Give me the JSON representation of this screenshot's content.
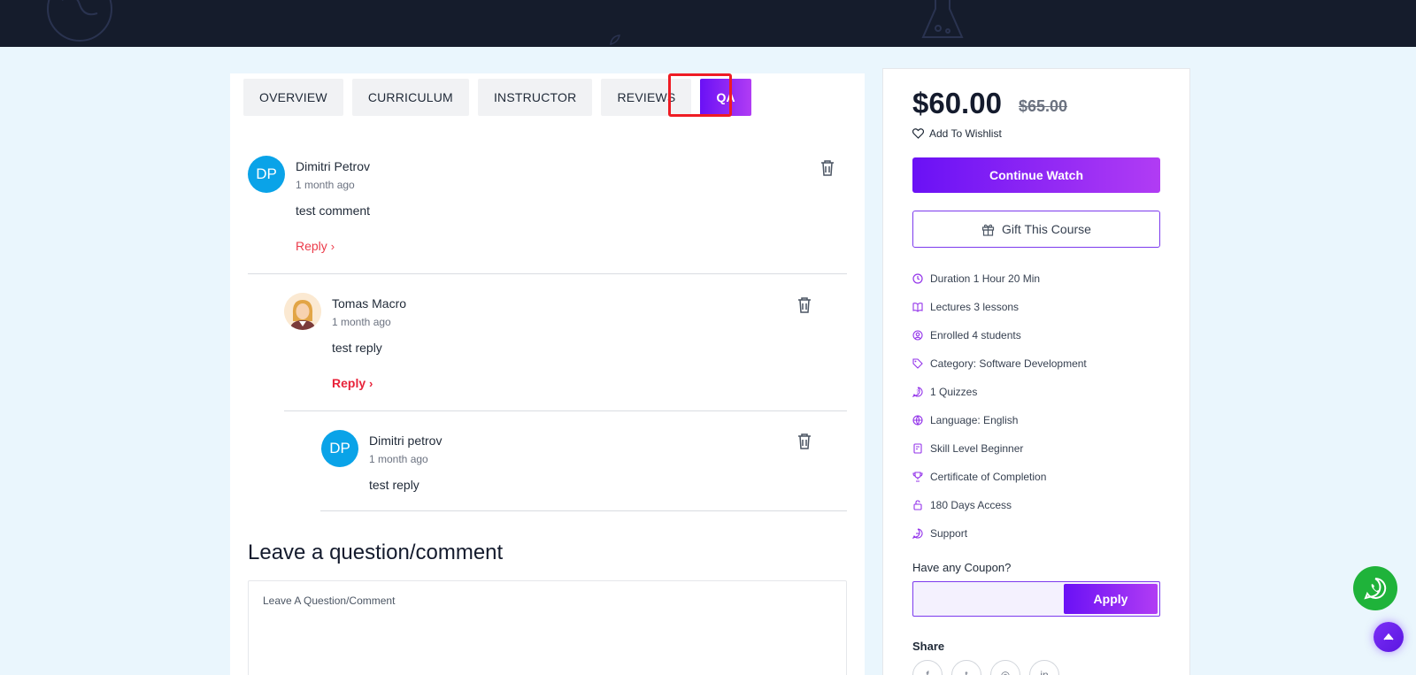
{
  "tabs": [
    {
      "label": "OVERVIEW",
      "active": false
    },
    {
      "label": "CURRICULUM",
      "active": false
    },
    {
      "label": "INSTRUCTOR",
      "active": false
    },
    {
      "label": "REVIEWS",
      "active": false
    },
    {
      "label": "QA",
      "active": true
    }
  ],
  "comments": [
    {
      "initials": "DP",
      "name": "Dimitri Petrov",
      "time": "1 month ago",
      "text": "test comment",
      "reply": "Reply"
    },
    {
      "initials": "",
      "name": "Tomas Macro",
      "time": "1 month ago",
      "text": "test reply",
      "reply": "Reply"
    },
    {
      "initials": "DP",
      "name": "Dimitri petrov",
      "time": "1 month ago",
      "text": "test reply"
    }
  ],
  "leave_comment": {
    "title": "Leave a question/comment",
    "placeholder": "Leave A Question/Comment"
  },
  "sidebar": {
    "price": "$60.00",
    "old_price": "$65.00",
    "wishlist_label": "Add To Wishlist",
    "continue_label": "Continue Watch",
    "gift_label": "Gift This Course",
    "info": [
      {
        "icon": "clock-icon",
        "text": "Duration 1 Hour 20 Min"
      },
      {
        "icon": "book-icon",
        "text": "Lectures 3 lessons"
      },
      {
        "icon": "user-icon",
        "text": "Enrolled 4 students"
      },
      {
        "icon": "tag-icon",
        "text": "Category: Software Development"
      },
      {
        "icon": "quiz-icon",
        "text": "1 Quizzes"
      },
      {
        "icon": "globe-icon",
        "text": "Language: English"
      },
      {
        "icon": "level-icon",
        "text": "Skill Level Beginner"
      },
      {
        "icon": "trophy-icon",
        "text": "Certificate of Completion"
      },
      {
        "icon": "lock-icon",
        "text": "180 Days Access"
      },
      {
        "icon": "support-icon",
        "text": "Support"
      }
    ],
    "coupon_label": "Have any Coupon?",
    "apply_label": "Apply",
    "share_label": "Share",
    "share_icons": [
      {
        "name": "facebook-icon",
        "glyph": "f"
      },
      {
        "name": "twitter-icon",
        "glyph": "t"
      },
      {
        "name": "instagram-icon",
        "glyph": "◎"
      },
      {
        "name": "linkedin-icon",
        "glyph": "in"
      }
    ]
  },
  "colors": {
    "accent_start": "#6a11f5",
    "accent_end": "#b13cf4",
    "reply": "#ec3b4a",
    "avatar_blue": "#0aa3e8",
    "whatsapp": "#1fb33a",
    "topbar": "#151c2c",
    "background": "#eaf6fd"
  }
}
